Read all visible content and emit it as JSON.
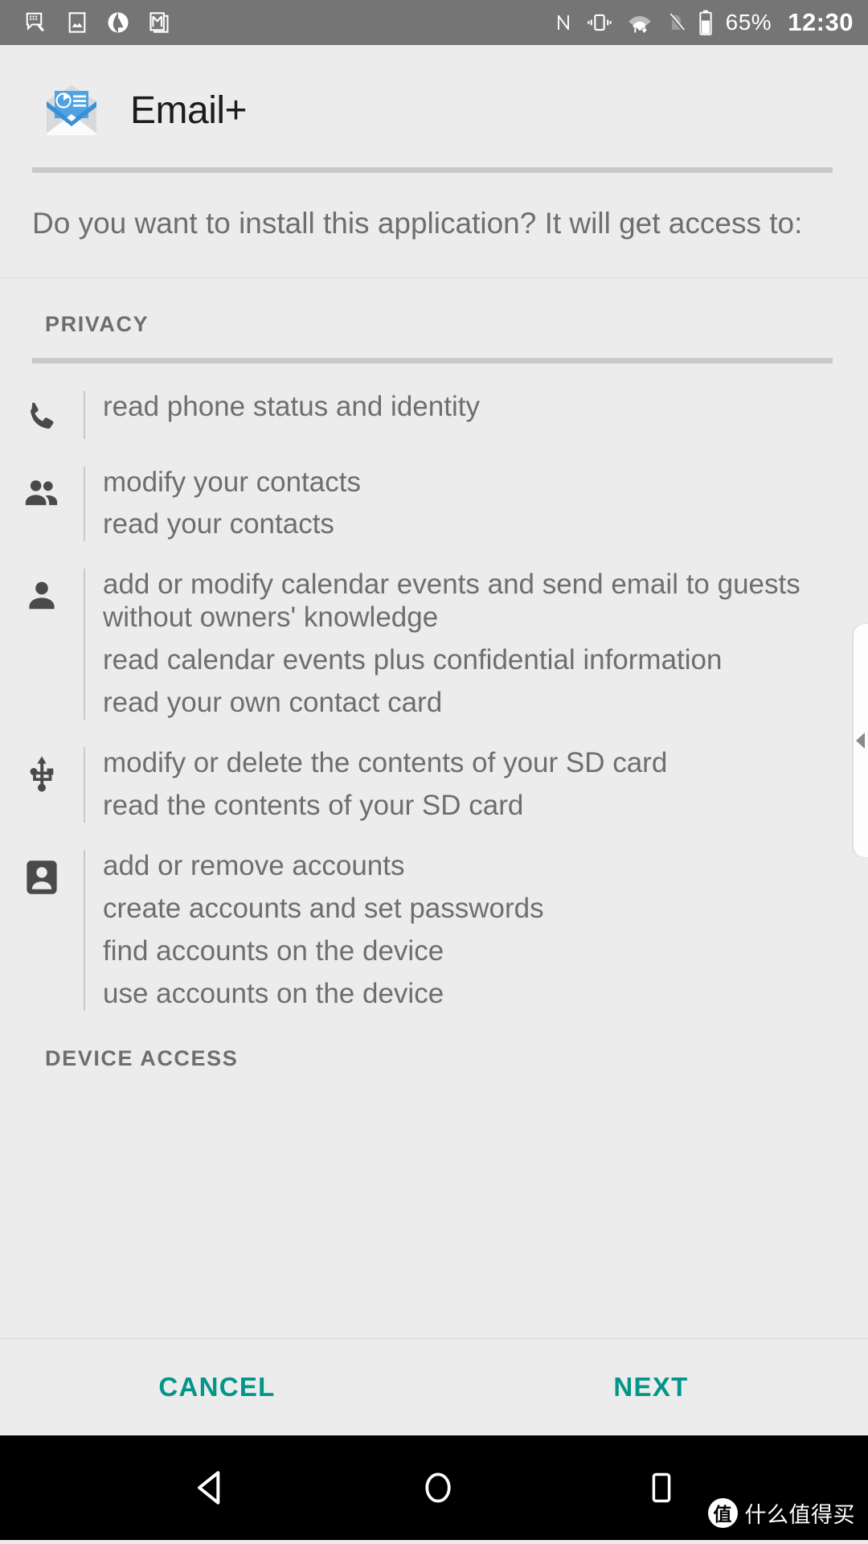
{
  "statusbar": {
    "left_icons": [
      "messaging-icon",
      "gallery-icon",
      "maps-icon",
      "gmail-icon"
    ],
    "right_icons": [
      "nfc-icon",
      "vibrate-icon",
      "wifi-data-icon",
      "no-sim-icon",
      "battery-icon"
    ],
    "battery": "65%",
    "clock": "12:30"
  },
  "header": {
    "app_name": "Email+",
    "app_icon": "email-envelope-icon"
  },
  "prompt": "Do you want to install this application? It will get access to:",
  "groups": [
    {
      "title": "PRIVACY",
      "permissions": [
        {
          "icon": "phone-icon",
          "lines": [
            "read phone status and identity"
          ]
        },
        {
          "icon": "contacts-icon",
          "lines": [
            "modify your contacts",
            "read your contacts"
          ]
        },
        {
          "icon": "person-icon",
          "lines": [
            "add or modify calendar events and send email to guests without owners' knowledge",
            "read calendar events plus confidential information",
            "read your own contact card"
          ]
        },
        {
          "icon": "usb-icon",
          "lines": [
            "modify or delete the contents of your SD card",
            "read the contents of your SD card"
          ]
        },
        {
          "icon": "account-badge-icon",
          "lines": [
            "add or remove accounts",
            "create accounts and set passwords",
            "find accounts on the device",
            "use accounts on the device"
          ]
        }
      ]
    }
  ],
  "next_group_title": "DEVICE ACCESS",
  "buttons": {
    "cancel": "CANCEL",
    "next": "NEXT",
    "accent_color": "#009688"
  },
  "navbar": {
    "back": "back-icon",
    "home": "home-icon",
    "recents": "recents-icon"
  },
  "watermark": {
    "badge": "值",
    "text": "什么值得买"
  }
}
